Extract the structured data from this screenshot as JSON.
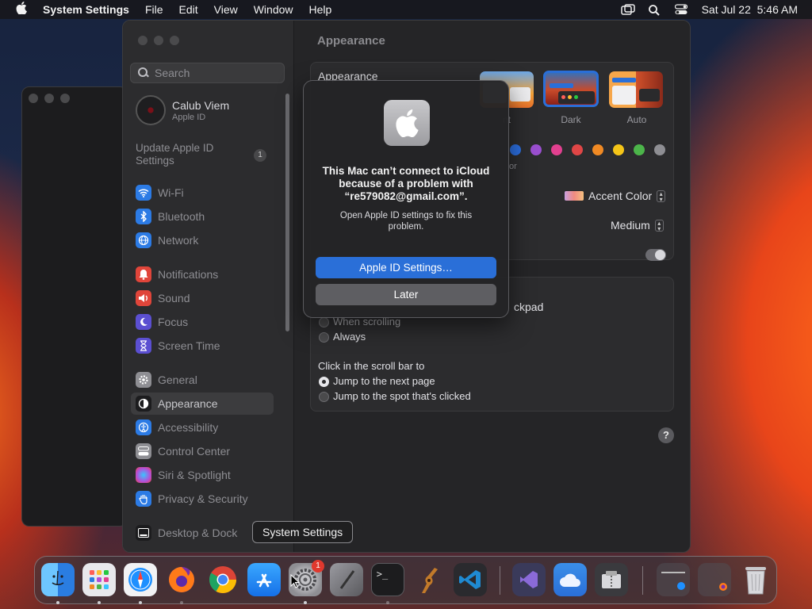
{
  "menubar": {
    "app_name": "System Settings",
    "menus": [
      "File",
      "Edit",
      "View",
      "Window",
      "Help"
    ],
    "clock": "Sat Jul 22  5:46 AM",
    "icons": [
      "apple-icon",
      "screen-mirroring-icon",
      "spotlight-search-icon",
      "control-center-icon"
    ]
  },
  "sidebar": {
    "search_placeholder": "Search",
    "account_name": "Calub Viem",
    "account_sub": "Apple ID",
    "update_text": "Update Apple ID Settings",
    "update_badge": "1",
    "items": [
      {
        "label": "Wi-Fi",
        "icon": "wifi-icon",
        "color": "#2c7be5"
      },
      {
        "label": "Bluetooth",
        "icon": "bluetooth-icon",
        "color": "#2c7be5"
      },
      {
        "label": "Network",
        "icon": "globe-icon",
        "color": "#2c7be5"
      },
      {
        "label": "Notifications",
        "icon": "bell-icon",
        "color": "#e0453a"
      },
      {
        "label": "Sound",
        "icon": "speaker-icon",
        "color": "#e0453a"
      },
      {
        "label": "Focus",
        "icon": "moon-icon",
        "color": "#5b4fd1"
      },
      {
        "label": "Screen Time",
        "icon": "hourglass-icon",
        "color": "#5b4fd1"
      },
      {
        "label": "General",
        "icon": "gear-icon",
        "color": "#8e8e93"
      },
      {
        "label": "Appearance",
        "icon": "appearance-icon",
        "color": "#1c1c1e"
      },
      {
        "label": "Accessibility",
        "icon": "accessibility-icon",
        "color": "#2c7be5"
      },
      {
        "label": "Control Center",
        "icon": "control-center-icon",
        "color": "#8e8e93"
      },
      {
        "label": "Siri & Spotlight",
        "icon": "siri-icon",
        "color": "#b44fd8"
      },
      {
        "label": "Privacy & Security",
        "icon": "hand-icon",
        "color": "#2c7be5"
      },
      {
        "label": "Desktop & Dock",
        "icon": "dock-icon",
        "color": "#1c1c1e"
      }
    ],
    "selected": "Appearance"
  },
  "content": {
    "title": "Appearance",
    "appearance_label": "Appearance",
    "modes": [
      "Light",
      "Dark",
      "Auto"
    ],
    "mode_labels": [
      "nt",
      "Dark",
      "Auto"
    ],
    "selected_mode": "Dark",
    "accent_colors": [
      "#2c6fe0",
      "#9a4fcf",
      "#e2408f",
      "#e04646",
      "#f08a24",
      "#f5c518",
      "#4cb54a",
      "#8e8e93"
    ],
    "accent_fragment": "or",
    "highlight_value": "Accent Color",
    "sidebar_size_value": "Medium",
    "scroll_partial": "ckpad",
    "show_scroll_options": [
      "When scrolling",
      "Always"
    ],
    "click_scroll_label": "Click in the scroll bar to",
    "click_scroll_options": [
      "Jump to the next page",
      "Jump to the spot that's clicked"
    ],
    "click_scroll_selected": 0,
    "help": "?"
  },
  "dialog": {
    "title": "This Mac can’t connect to iCloud because of a problem with “re579082@gmail.com”.",
    "message": "Open Apple ID settings to fix this problem.",
    "primary_button": "Apple ID Settings…",
    "secondary_button": "Later"
  },
  "tooltip": "System Settings",
  "dock": {
    "apps": [
      "Finder",
      "Launchpad",
      "Safari",
      "Firefox",
      "Chrome",
      "App Store",
      "System Settings",
      "Script Editor",
      "Terminal",
      "GarageBand",
      "Visual Studio Code",
      "Visual Studio",
      "Weather",
      "Archive Utility",
      "Downloads Stack",
      "Firefox Stack",
      "Trash"
    ],
    "system_settings_badge": "1"
  }
}
